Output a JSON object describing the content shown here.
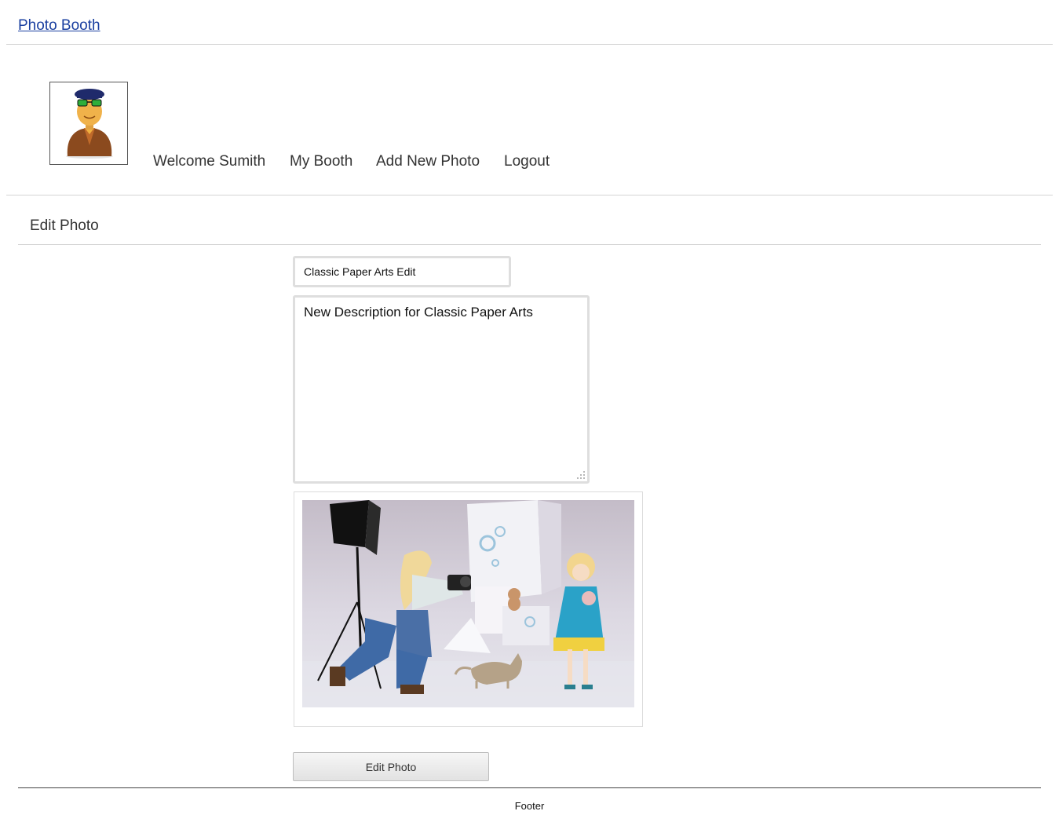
{
  "header": {
    "site_title": "Photo Booth"
  },
  "user": {
    "avatar_icon": "user-avatar-icon"
  },
  "nav": {
    "items": [
      {
        "label": "Welcome Sumith"
      },
      {
        "label": "My Booth"
      },
      {
        "label": "Add New Photo"
      },
      {
        "label": "Logout"
      }
    ]
  },
  "page": {
    "title": "Edit Photo"
  },
  "form": {
    "title_value": "Classic Paper Arts Edit",
    "description_value": "New Description for Classic Paper Arts",
    "submit_label": "Edit Photo"
  },
  "footer": {
    "text": "Footer"
  },
  "colors": {
    "link": "#1a3fa0",
    "text": "#333333",
    "divider": "#d4d4d4"
  }
}
